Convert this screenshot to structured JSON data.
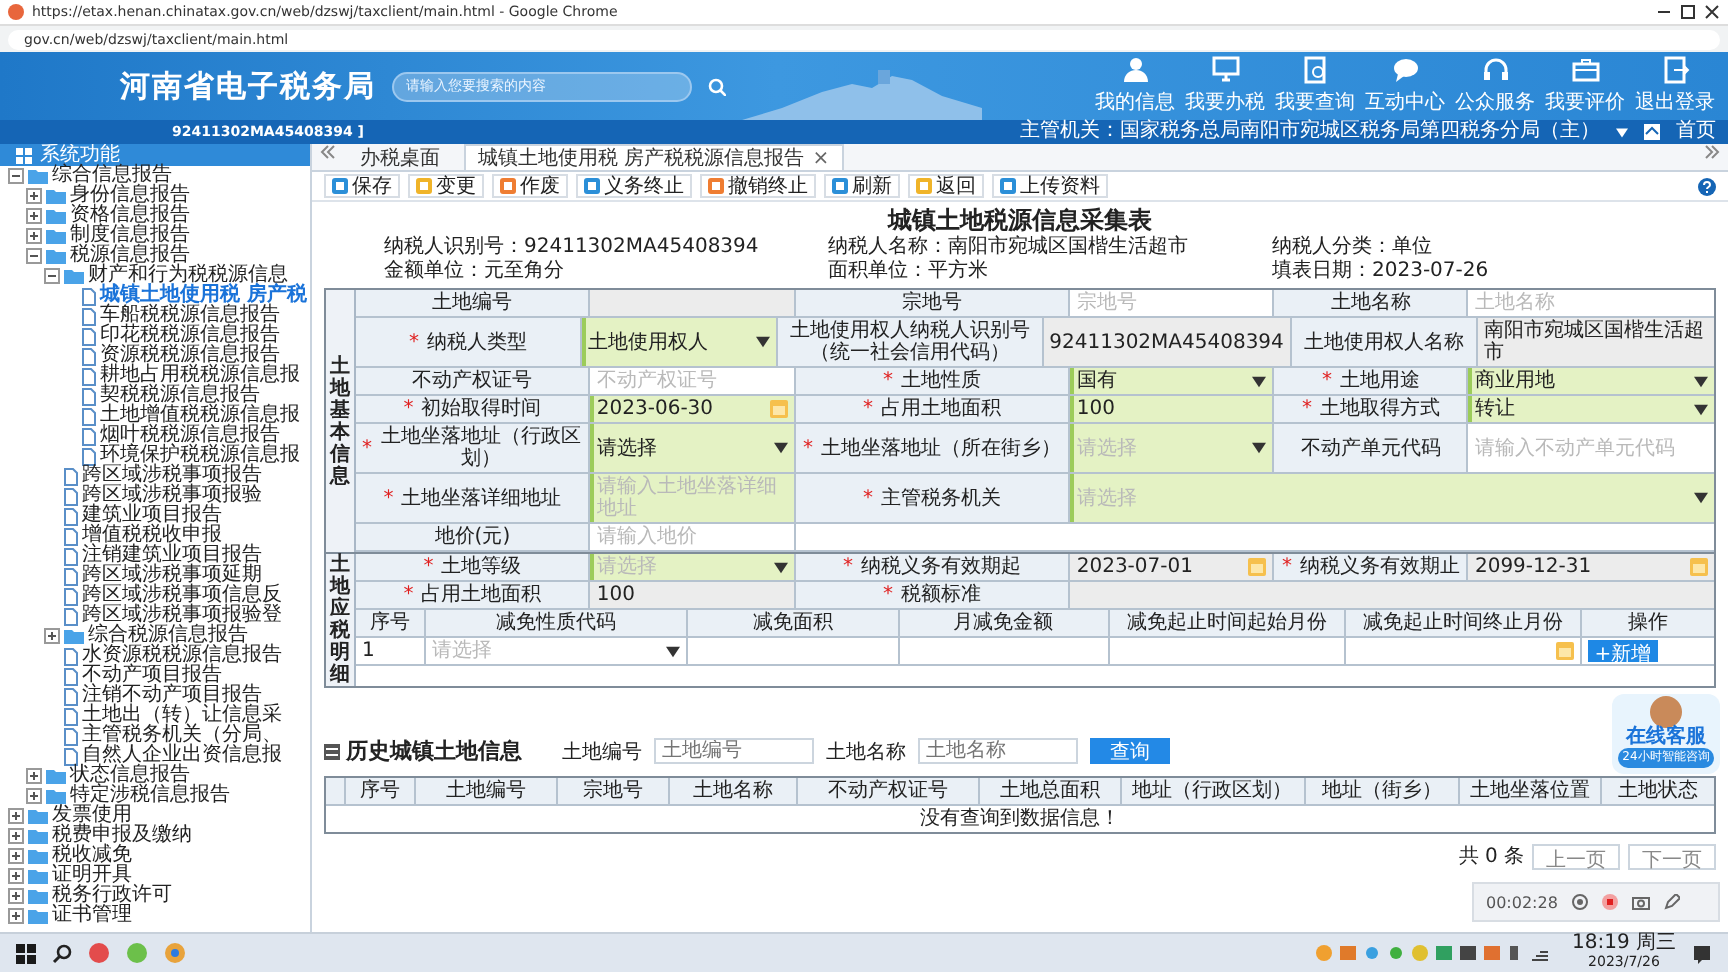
{
  "browser": {
    "title": "https://etax.henan.chinatax.gov.cn/web/dzswj/taxclient/main.html - Google Chrome",
    "address": "gov.cn/web/dzswj/taxclient/main.html"
  },
  "header": {
    "site_name": "河南省电子税务局",
    "search": {
      "placeholder": "请输入您要搜索的内容"
    },
    "nav": [
      {
        "label": "我的信息"
      },
      {
        "label": "我要办税"
      },
      {
        "label": "我要查询"
      },
      {
        "label": "互动中心"
      },
      {
        "label": "公众服务"
      },
      {
        "label": "我要评价"
      },
      {
        "label": "退出登录"
      }
    ]
  },
  "user_bar": {
    "taxpayer_id": "92411302MA45408394 ]",
    "authority": "主管机关：国家税务总局南阳市宛城区税务局第四税务分局（主）",
    "home": "首页"
  },
  "sidebar": {
    "title": "系统功能",
    "items": [
      {
        "label": "综合信息报告",
        "expanded": true,
        "selected": false,
        "children": [
          {
            "label": "身份信息报告",
            "expanded": false,
            "selected": false
          },
          {
            "label": "资格信息报告",
            "expanded": false,
            "selected": false
          },
          {
            "label": "制度信息报告",
            "expanded": false,
            "selected": false
          },
          {
            "label": "税源信息报告",
            "expanded": true,
            "selected": false,
            "children": [
              {
                "label": "财产和行为税税源信息",
                "expanded": true,
                "selected": false,
                "children": [
                  {
                    "label": "城镇土地使用税 房产税",
                    "selected": true
                  },
                  {
                    "label": "车船税税源信息报告",
                    "selected": false
                  },
                  {
                    "label": "印花税税源信息报告",
                    "selected": false
                  },
                  {
                    "label": "资源税税源信息报告",
                    "selected": false
                  },
                  {
                    "label": "耕地占用税税源信息报",
                    "selected": false
                  },
                  {
                    "label": "契税税源信息报告",
                    "selected": false
                  },
                  {
                    "label": "土地增值税税源信息报",
                    "selected": false
                  },
                  {
                    "label": "烟叶税税源信息报告",
                    "selected": false
                  },
                  {
                    "label": "环境保护税税源信息报",
                    "selected": false
                  }
                ]
              },
              {
                "label": "跨区域涉税事项报告",
                "selected": false
              },
              {
                "label": "跨区域涉税事项报验",
                "selected": false
              },
              {
                "label": "建筑业项目报告",
                "selected": false
              },
              {
                "label": "增值税税收申报",
                "selected": false
              },
              {
                "label": "注销建筑业项目报告",
                "selected": false
              },
              {
                "label": "跨区域涉税事项延期",
                "selected": false
              },
              {
                "label": "跨区域涉税事项信息反",
                "selected": false
              },
              {
                "label": "跨区域涉税事项报验登",
                "selected": false
              },
              {
                "label": "综合税源信息报告",
                "expanded": false,
                "selected": false
              },
              {
                "label": "水资源税税源信息报告",
                "selected": false
              },
              {
                "label": "不动产项目报告",
                "selected": false
              },
              {
                "label": "注销不动产项目报告",
                "selected": false
              },
              {
                "label": "土地出（转）让信息采",
                "selected": false
              },
              {
                "label": "主管税务机关（分局、",
                "selected": false
              },
              {
                "label": "自然人企业出资信息报",
                "selected": false
              }
            ]
          },
          {
            "label": "状态信息报告",
            "expanded": false,
            "selected": false
          },
          {
            "label": "特定涉税信息报告",
            "expanded": false,
            "selected": false
          }
        ]
      },
      {
        "label": "发票使用",
        "expanded": false,
        "selected": false
      },
      {
        "label": "税费申报及缴纳",
        "expanded": false,
        "selected": false
      },
      {
        "label": "税收减免",
        "expanded": false,
        "selected": false
      },
      {
        "label": "证明开具",
        "expanded": false,
        "selected": false
      },
      {
        "label": "税务行政许可",
        "expanded": false,
        "selected": false
      },
      {
        "label": "证书管理",
        "expanded": false,
        "selected": false
      }
    ]
  },
  "tabs": [
    {
      "label": "办税桌面",
      "selected": false
    },
    {
      "label": "城镇土地使用税 房产税税源信息报告",
      "selected": true,
      "close": "×"
    }
  ],
  "toolbar": [
    {
      "label": "保存",
      "color": "#2b8fd8"
    },
    {
      "label": "变更",
      "color": "#f0b429"
    },
    {
      "label": "作废",
      "color": "#ef7d32"
    },
    {
      "label": "义务终止",
      "color": "#2b8fd8"
    },
    {
      "label": "撤销终止",
      "color": "#ef7d32"
    },
    {
      "label": "刷新",
      "color": "#2b8fd8"
    },
    {
      "label": "返回",
      "color": "#f0b429"
    },
    {
      "label": "上传资料",
      "color": "#2b8fd8"
    }
  ],
  "form": {
    "title": "城镇土地税源信息采集表",
    "info": [
      "纳税人识别号：92411302MA45408394",
      "纳税人名称：南阳市宛城区国楷生活超市",
      "纳税人分类：单位",
      "金额单位：元至角分",
      "面积单位：平方米",
      "填表日期：2023-07-26"
    ],
    "sections": [
      {
        "title": "土地基本信息",
        "rows": [
          {
            "cells": [
              {
                "kind": "label",
                "text": "土地编号"
              },
              {
                "kind": "text",
                "required": false,
                "readonly": true
              },
              {
                "kind": "label",
                "text": "宗地号"
              },
              {
                "kind": "text",
                "required": false,
                "readonly": false,
                "placeholder": "宗地号"
              },
              {
                "kind": "label",
                "text": "土地名称"
              },
              {
                "kind": "text",
                "required": false,
                "readonly": false,
                "placeholder": "土地名称"
              }
            ]
          },
          {
            "cells": [
              {
                "kind": "label",
                "asterisk": "*",
                "text": "纳税人类型"
              },
              {
                "kind": "select",
                "required": true,
                "readonly": false,
                "value": "土地使用权人"
              },
              {
                "kind": "label",
                "text": "土地使用权人纳税人识别号（统一社会信用代码）"
              },
              {
                "kind": "text",
                "required": false,
                "readonly": true,
                "value": "92411302MA45408394"
              },
              {
                "kind": "label",
                "text": "土地使用权人名称"
              },
              {
                "kind": "text",
                "required": false,
                "readonly": true,
                "value": "南阳市宛城区国楷生活超市"
              }
            ]
          },
          {
            "cells": [
              {
                "kind": "label",
                "text": "不动产权证号"
              },
              {
                "kind": "text",
                "required": false,
                "readonly": false,
                "placeholder": "不动产权证号"
              },
              {
                "kind": "label",
                "asterisk": "*",
                "text": "土地性质"
              },
              {
                "kind": "select",
                "required": true,
                "readonly": false,
                "value": "国有"
              },
              {
                "kind": "label",
                "asterisk": "*",
                "text": "土地用途"
              },
              {
                "kind": "select",
                "required": true,
                "readonly": false,
                "value": "商业用地"
              }
            ]
          },
          {
            "cells": [
              {
                "kind": "label",
                "asterisk": "*",
                "text": "初始取得时间"
              },
              {
                "kind": "date",
                "required": true,
                "readonly": false,
                "value": "2023-06-30"
              },
              {
                "kind": "label",
                "asterisk": "*",
                "text": "占用土地面积"
              },
              {
                "kind": "text",
                "required": true,
                "readonly": false,
                "value": "100"
              },
              {
                "kind": "label",
                "asterisk": "*",
                "text": "土地取得方式"
              },
              {
                "kind": "select",
                "required": true,
                "readonly": false,
                "value": "转让"
              }
            ]
          },
          {
            "cells": [
              {
                "kind": "label",
                "asterisk": "*",
                "text": "土地坐落地址（行政区划）"
              },
              {
                "kind": "select",
                "required": true,
                "readonly": false,
                "value": "请选择"
              },
              {
                "kind": "label",
                "asterisk": "*",
                "text": "土地坐落地址（所在街乡）"
              },
              {
                "kind": "select",
                "required": true,
                "readonly": false,
                "placeholder": "请选择"
              },
              {
                "kind": "label",
                "text": "不动产单元代码"
              },
              {
                "kind": "text",
                "required": false,
                "readonly": false,
                "placeholder": "请输入不动产单元代码"
              }
            ]
          },
          {
            "cells": [
              {
                "kind": "label",
                "asterisk": "*",
                "text": "土地坐落详细地址"
              },
              {
                "kind": "text",
                "required": true,
                "readonly": false,
                "placeholder": "请输入土地坐落详细地址"
              },
              {
                "kind": "label",
                "asterisk": "*",
                "text": "主管税务机关"
              },
              {
                "kind": "select",
                "required": true,
                "readonly": false,
                "placeholder": "请选择"
              }
            ]
          },
          {
            "cells": [
              {
                "kind": "label",
                "text": "地价(元)"
              },
              {
                "kind": "text",
                "required": false,
                "readonly": false,
                "placeholder": "请输入地价"
              },
              {
                "kind": "blank"
              }
            ]
          }
        ]
      },
      {
        "title": "土地应税明细",
        "rows": [
          {
            "cells": [
              {
                "kind": "label",
                "asterisk": "*",
                "text": "土地等级"
              },
              {
                "kind": "select",
                "required": true,
                "readonly": false,
                "placeholder": "请选择"
              },
              {
                "kind": "label",
                "asterisk": "*",
                "text": "纳税义务有效期起"
              },
              {
                "kind": "date",
                "required": false,
                "readonly": true,
                "value": "2023-07-01"
              },
              {
                "kind": "label",
                "asterisk": "*",
                "text": "纳税义务有效期止"
              },
              {
                "kind": "date",
                "required": false,
                "readonly": true,
                "value": "2099-12-31"
              }
            ]
          },
          {
            "cells": [
              {
                "kind": "label",
                "asterisk": "*",
                "text": "占用土地面积"
              },
              {
                "kind": "text",
                "required": false,
                "readonly": true,
                "value": "100"
              },
              {
                "kind": "label",
                "asterisk": "*",
                "text": "税额标准"
              },
              {
                "kind": "text",
                "required": false,
                "readonly": true
              }
            ]
          }
        ],
        "table": {
          "columns": [
            "序号",
            "减免性质代码",
            "减免面积",
            "月减免金额",
            "减免起止时间起始月份",
            "减免起止时间终止月份",
            "操作"
          ],
          "rows": [
            {
              "cells": [
                {
                  "kind": "index",
                  "text": "1"
                },
                {
                  "kind": "select",
                  "required": false,
                  "readonly": false,
                  "placeholder": "请选择"
                },
                {
                  "kind": "text",
                  "required": false,
                  "readonly": false
                },
                {
                  "kind": "text",
                  "required": false,
                  "readonly": false
                },
                {
                  "kind": "text",
                  "required": false,
                  "readonly": false
                },
                {
                  "kind": "date",
                  "required": false,
                  "readonly": false
                },
                {
                  "kind": "action",
                  "text": "+新增"
                }
              ]
            }
          ]
        }
      }
    ]
  },
  "history": {
    "title": "历史城镇土地信息",
    "filters": [
      {
        "label": "土地编号",
        "placeholder": "土地编号"
      },
      {
        "label": "土地名称",
        "placeholder": "土地名称"
      }
    ],
    "search_button": "查询",
    "columns": [
      "序号",
      "土地编号",
      "宗地号",
      "土地名称",
      "不动产权证号",
      "土地总面积",
      "地址（行政区划）",
      "地址（街乡）",
      "土地坐落位置",
      "土地状态"
    ],
    "empty_message": "没有查询到数据信息！"
  },
  "pagination": {
    "total": "共 0 条",
    "prev": "上一页",
    "next": "下一页"
  },
  "chat_widget": {
    "title": "在线客服",
    "subtitle": "24小时智能咨询"
  },
  "recorder": {
    "time": "00:02:28"
  },
  "taskbar": {
    "time": "18:19 周三",
    "date": "2023/7/26"
  }
}
